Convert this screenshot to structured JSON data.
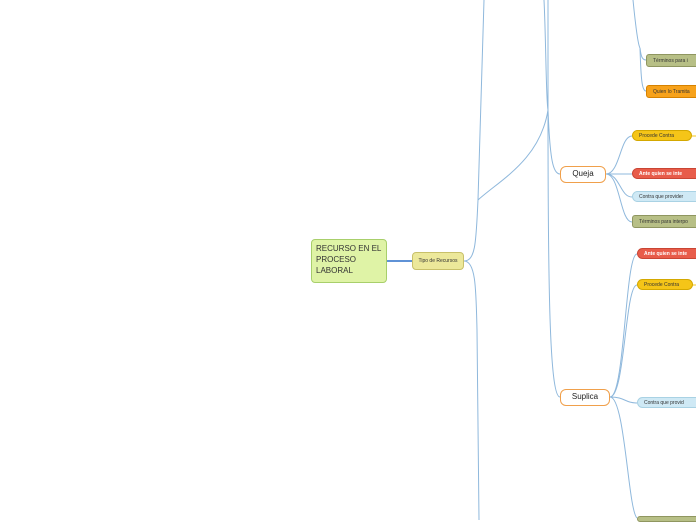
{
  "root": {
    "label": "RECURSO EN EL PROCESO LABORAL"
  },
  "level1": {
    "label": "Tipo de Recursos"
  },
  "queja": {
    "label": "Queja",
    "children": [
      "Procede Contra",
      "Ante quien se inte",
      "Contra que provider",
      "Términos para interpo"
    ]
  },
  "suplica": {
    "label": "Suplica",
    "children": [
      "Ante quien se inte",
      "Procede Contra",
      "Contra que provid"
    ]
  },
  "top": {
    "children": [
      "Términos para i",
      "Quien lo Tramita"
    ]
  },
  "colors": {
    "line": "#8fb8dc",
    "yellow": "#f5c518",
    "red": "#e85c4a",
    "blue": "#cfe9f5",
    "olive": "#b7bf86",
    "orange": "#f7a21b"
  }
}
